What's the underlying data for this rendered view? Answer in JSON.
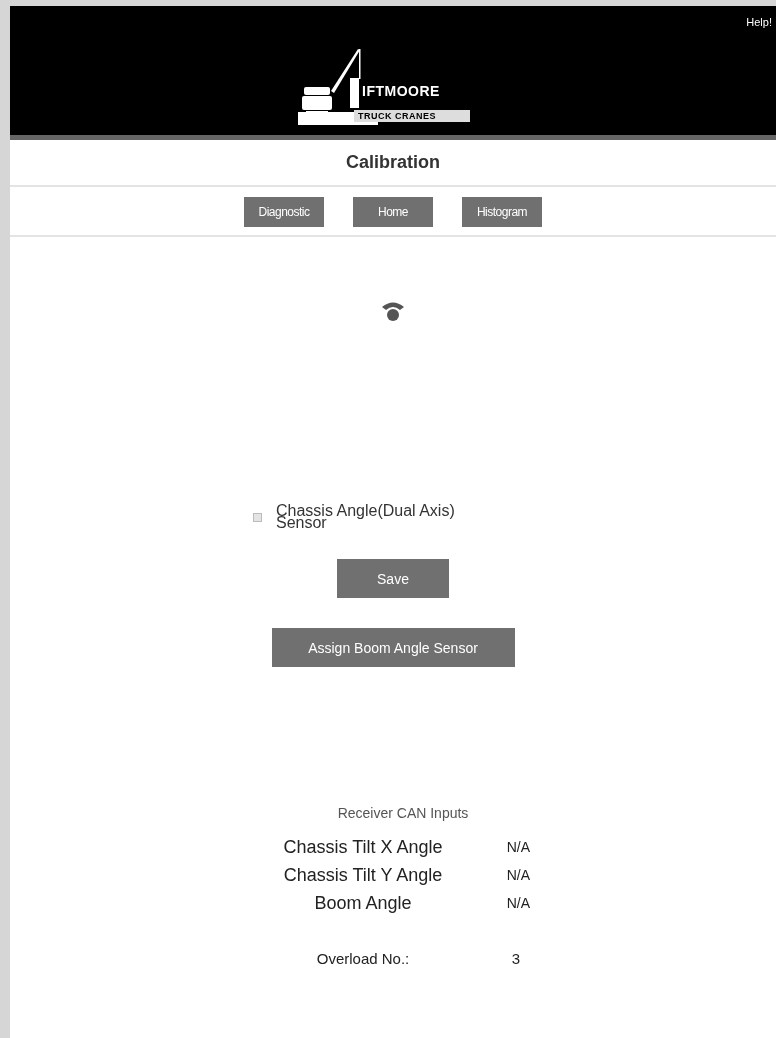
{
  "header": {
    "help_link": "Help!",
    "logo": {
      "name": "IFTMOORE",
      "tagline": "TRUCK CRANES"
    }
  },
  "title": "Calibration",
  "nav": [
    {
      "label": "Diagnostic"
    },
    {
      "label": "Home"
    },
    {
      "label": "Histogram"
    }
  ],
  "sensor_option": {
    "label": "Chassis Angle(Dual Axis) Sensor",
    "checked": false
  },
  "buttons": [
    {
      "label": "Save",
      "kind": "narrow"
    },
    {
      "label": "Assign Boom Angle Sensor",
      "kind": "wide"
    }
  ],
  "inputs": {
    "heading": "Receiver CAN Inputs",
    "rows": [
      {
        "name": "Chassis Tilt X Angle",
        "value": "N/A"
      },
      {
        "name": "Chassis Tilt Y Angle",
        "value": "N/A"
      },
      {
        "name": "Boom Angle",
        "value": "N/A"
      }
    ]
  },
  "overload": {
    "label": "Overload No.:",
    "value": "3"
  }
}
